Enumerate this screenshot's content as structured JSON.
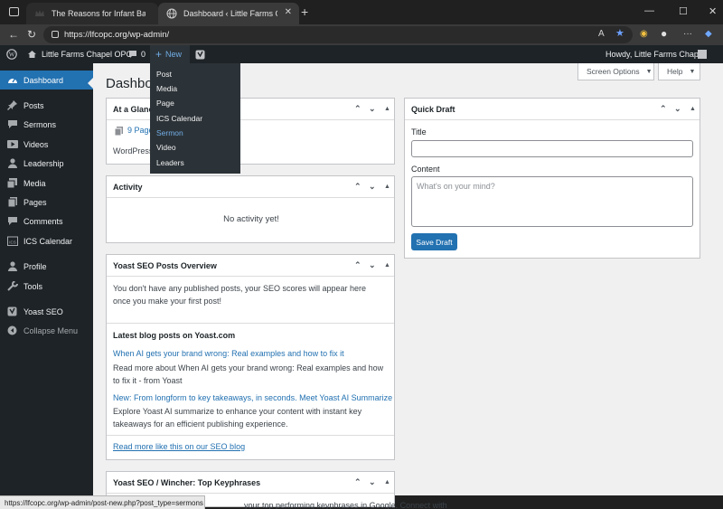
{
  "browser": {
    "tabs": [
      {
        "title": "The Reasons for Infant Baptism | ..."
      },
      {
        "title": "Dashboard ‹ Little Farms Chapel O..."
      }
    ],
    "url": "https://lfcopc.org/wp-admin/",
    "status_url": "https://lfcopc.org/wp-admin/post-new.php?post_type=sermons"
  },
  "adminbar": {
    "site_name": "Little Farms Chapel OPC",
    "comments_count": "0",
    "new_label": "New",
    "howdy": "Howdy, Little Farms Chapel"
  },
  "new_menu": [
    "Post",
    "Media",
    "Page",
    "ICS Calendar",
    "Sermon",
    "Video",
    "Leaders"
  ],
  "sidebar": {
    "items": [
      {
        "label": "Dashboard",
        "icon": "dashboard-icon"
      },
      {
        "label": "Posts",
        "icon": "pin-icon"
      },
      {
        "label": "Sermons",
        "icon": "speech-icon"
      },
      {
        "label": "Videos",
        "icon": "video-icon"
      },
      {
        "label": "Leadership",
        "icon": "person-icon"
      },
      {
        "label": "Media",
        "icon": "media-icon"
      },
      {
        "label": "Pages",
        "icon": "pages-icon"
      },
      {
        "label": "Comments",
        "icon": "comments-icon"
      },
      {
        "label": "ICS Calendar",
        "icon": "calendar-icon"
      },
      {
        "label": "Profile",
        "icon": "profile-icon"
      },
      {
        "label": "Tools",
        "icon": "wrench-icon"
      },
      {
        "label": "Yoast SEO",
        "icon": "yoast-icon"
      },
      {
        "label": "Collapse Menu",
        "icon": "collapse-icon"
      }
    ]
  },
  "page": {
    "title": "Dashboard",
    "screen_options": "Screen Options",
    "help": "Help"
  },
  "at_a_glance": {
    "title": "At a Glance",
    "pages_link": "9 Pages",
    "wordpress_text": "WordPress"
  },
  "activity": {
    "title": "Activity",
    "empty": "No activity yet!"
  },
  "yoast_overview": {
    "title": "Yoast SEO Posts Overview",
    "message": "You don't have any published posts, your SEO scores will appear here once you make your first post!",
    "latest_heading": "Latest blog posts on Yoast.com",
    "posts": [
      {
        "title": "When AI gets your brand wrong: Real examples and how to fix it",
        "excerpt": "Read more about When AI gets your brand wrong: Real examples and how to fix it - from Yoast"
      },
      {
        "title": "New: From longform to key takeaways, in seconds. Meet Yoast AI Summarize",
        "excerpt": "Explore Yoast AI summarize to enhance your content with instant key takeaways for an efficient publishing experience."
      }
    ],
    "read_more": "Read more like this on our SEO blog"
  },
  "yoast_wincher": {
    "title": "Yoast SEO / Wincher: Top Keyphrases",
    "text": "your top performing keyphrases in Google. Connect with"
  },
  "quick_draft": {
    "title": "Quick Draft",
    "title_label": "Title",
    "content_label": "Content",
    "content_placeholder": "What's on your mind?",
    "save_label": "Save Draft"
  },
  "colors": {
    "admin_bar": "#1d2327",
    "accent": "#2271b1",
    "link_highlight": "#72aee6",
    "content_bg": "#f0f0f1"
  }
}
